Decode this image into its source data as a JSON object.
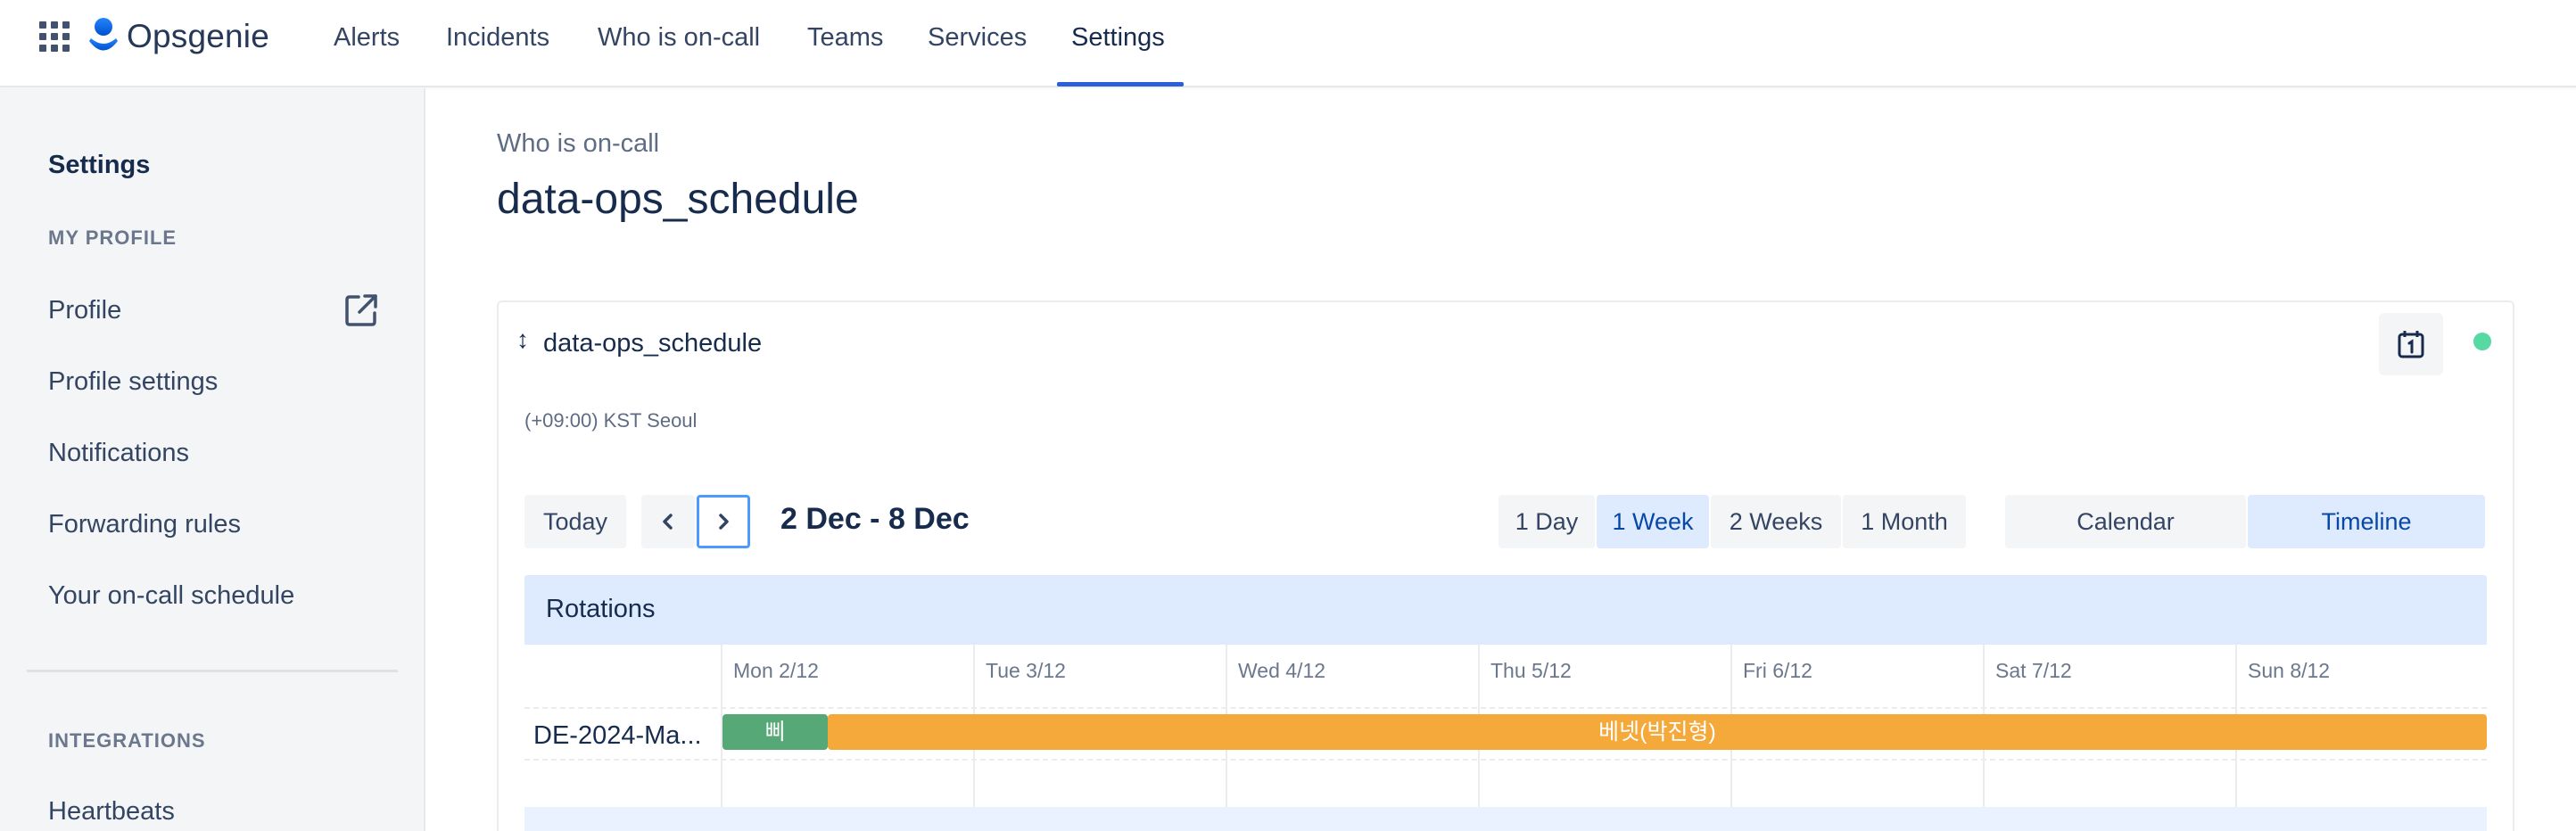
{
  "app": {
    "name": "Opsgenie"
  },
  "topnav": {
    "items": [
      {
        "label": "Alerts"
      },
      {
        "label": "Incidents"
      },
      {
        "label": "Who is on-call"
      },
      {
        "label": "Teams"
      },
      {
        "label": "Services"
      },
      {
        "label": "Settings",
        "active": true
      }
    ]
  },
  "sidebar": {
    "title": "Settings",
    "section_profile": "MY PROFILE",
    "items": [
      {
        "label": "Profile",
        "icon": "external-link-icon"
      },
      {
        "label": "Profile settings"
      },
      {
        "label": "Notifications"
      },
      {
        "label": "Forwarding rules"
      },
      {
        "label": "Your on-call schedule"
      }
    ],
    "section_integrations": "INTEGRATIONS",
    "integration_items": [
      {
        "label": "Heartbeats"
      }
    ]
  },
  "main": {
    "breadcrumb": "Who is on-call",
    "title": "data-ops_schedule"
  },
  "schedule": {
    "name": "data-ops_schedule",
    "timezone": "(+09:00) KST Seoul",
    "status_color": "#57d9a3",
    "today_label": "Today",
    "date_range": "2 Dec - 8 Dec",
    "range_options": [
      {
        "label": "1 Day",
        "selected": false
      },
      {
        "label": "1 Week",
        "selected": true
      },
      {
        "label": "2 Weeks",
        "selected": false
      },
      {
        "label": "1 Month",
        "selected": false
      }
    ],
    "view_options": [
      {
        "label": "Calendar",
        "selected": false
      },
      {
        "label": "Timeline",
        "selected": true
      }
    ],
    "rotations_label": "Rotations",
    "days": [
      "Mon 2/12",
      "Tue 3/12",
      "Wed 4/12",
      "Thu 5/12",
      "Fri 6/12",
      "Sat 7/12",
      "Sun 8/12"
    ],
    "rotation_row": {
      "name": "DE-2024-Ma...",
      "shifts": [
        {
          "label": "삐",
          "color": "#57a877"
        },
        {
          "label": "베넷(박진형)",
          "color": "#f4a93a"
        }
      ]
    }
  },
  "colors": {
    "accent": "#2b5fd9",
    "selected_bg": "#deebff",
    "selected_text": "#0747a6"
  }
}
